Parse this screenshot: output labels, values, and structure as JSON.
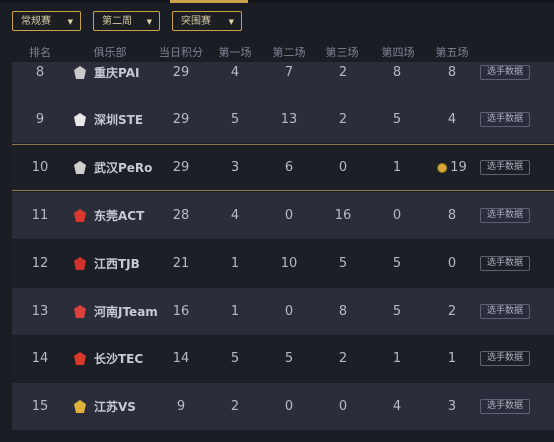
{
  "filters": [
    {
      "label": "常规赛"
    },
    {
      "label": "第二周"
    },
    {
      "label": "突围赛"
    }
  ],
  "columns": [
    "排名",
    "俱乐部",
    "当日积分",
    "第一场",
    "第二场",
    "第三场",
    "第四场",
    "第五场"
  ],
  "button_label": "选手数据",
  "rows": [
    {
      "rank": "8",
      "club": "重庆PAI",
      "points": "29",
      "g1": "4",
      "g2": "7",
      "g3": "2",
      "g4": "8",
      "g5": "8",
      "logo_color": "#c9c9c9"
    },
    {
      "rank": "9",
      "club": "深圳STE",
      "points": "29",
      "g1": "5",
      "g2": "13",
      "g3": "2",
      "g4": "5",
      "g5": "4",
      "logo_color": "#e8e8e8"
    },
    {
      "rank": "10",
      "club": "武汉PeRo",
      "points": "29",
      "g1": "3",
      "g2": "6",
      "g3": "0",
      "g4": "1",
      "g5": "19",
      "logo_color": "#cfcfcf"
    },
    {
      "rank": "11",
      "club": "东莞ACT",
      "points": "28",
      "g1": "4",
      "g2": "0",
      "g3": "16",
      "g4": "0",
      "g5": "8",
      "logo_color": "#d9392f"
    },
    {
      "rank": "12",
      "club": "江西TJB",
      "points": "21",
      "g1": "1",
      "g2": "10",
      "g3": "5",
      "g4": "5",
      "g5": "0",
      "logo_color": "#d0322a"
    },
    {
      "rank": "13",
      "club": "河南JTeam",
      "points": "16",
      "g1": "1",
      "g2": "0",
      "g3": "8",
      "g4": "5",
      "g5": "2",
      "logo_color": "#d9413a"
    },
    {
      "rank": "14",
      "club": "长沙TEC",
      "points": "14",
      "g1": "5",
      "g2": "5",
      "g3": "2",
      "g4": "1",
      "g5": "1",
      "logo_color": "#d8392b"
    },
    {
      "rank": "15",
      "club": "江苏VS",
      "points": "9",
      "g1": "2",
      "g2": "0",
      "g3": "0",
      "g4": "4",
      "g5": "3",
      "logo_color": "#e0b23a"
    }
  ]
}
